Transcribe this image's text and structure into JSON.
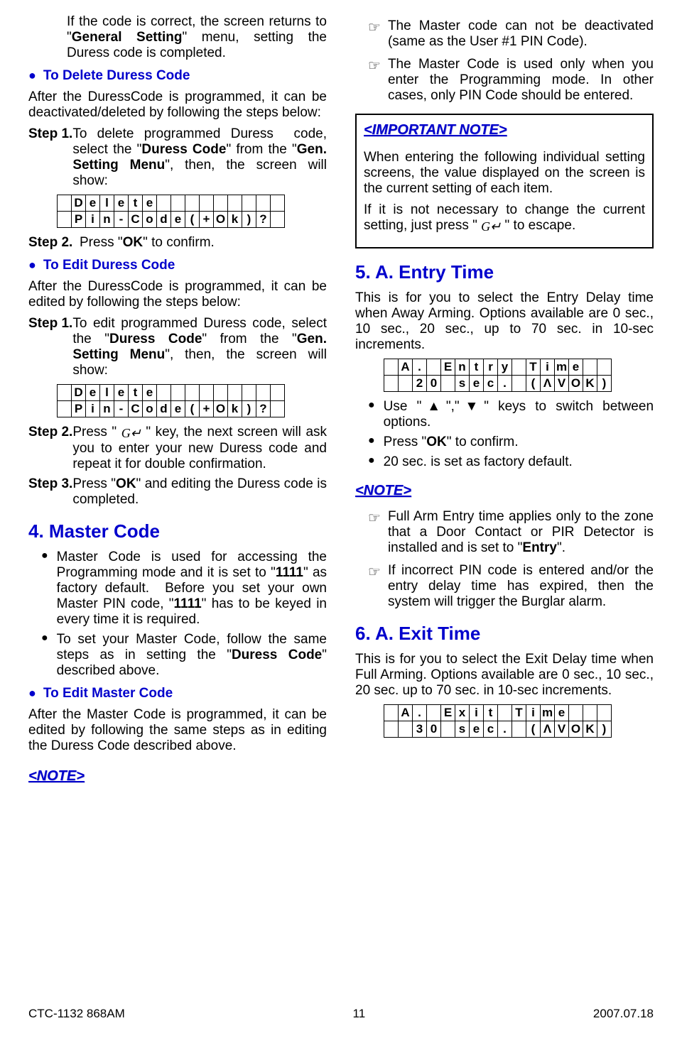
{
  "left": {
    "intro": "If the code is correct, the screen returns to \"General Setting\" menu, setting the Duress code is completed.",
    "delete_head": "To Delete Duress Code",
    "delete_intro": "After the DuressCode is programmed, it can be deactivated/deleted by following the steps below:",
    "delete_s1a": "Step 1.",
    "delete_s1b": "To delete programmed Duress  code, select the \"Duress Code\" from the \"Gen. Setting Menu\", then, the screen will show:",
    "lcd_delete_row1": [
      "",
      "",
      "D",
      "e",
      "l",
      "e",
      "t",
      "e",
      "",
      "",
      "",
      "",
      "",
      "",
      "",
      "",
      ""
    ],
    "lcd_delete_row2": [
      "",
      "",
      "P",
      "i",
      "n",
      "-",
      "C",
      "o",
      "d",
      "e",
      "(",
      "+",
      "O",
      "k",
      ")",
      "?"
    ],
    "delete_s2a": "Step  2.",
    "delete_s2b": "Press \"OK\" to confirm.",
    "edit_head": "To Edit Duress Code",
    "edit_intro": "After the DuressCode is programmed, it can be edited by following the steps below:",
    "edit_s1a": "Step 1.",
    "edit_s1b": "To edit programmed Duress code, select the \"Duress Code\" from the \"Gen. Setting Menu\", then, the screen will show:",
    "edit_s2a": "Step 2.",
    "edit_s2b_pre": "Press \" ",
    "edit_s2b_post": " \" key, the next screen will ask you to enter your new Duress code and repeat it for double confirmation.",
    "edit_s3a": "Step 3.",
    "edit_s3b": "Press \"OK\" and editing the Duress code is completed.",
    "master_head": "4. Master Code",
    "master_b1": "Master Code is used for accessing the Programming mode and it is set to \"1111\" as factory default.  Before you set your own Master PIN code, \"1111\" has to be keyed in every time it is required.",
    "master_b2": "To set your Master Code, follow the same steps as in setting the \"Duress Code\" described above.",
    "master_edit_head": "To Edit Master Code",
    "master_edit_txt": "After the Master Code is programmed, it can be edited by following the same steps as in editing the Duress Code described above.",
    "note_label": "<NOTE>"
  },
  "right": {
    "hand1": "The Master code can not be deactivated (same as the User #1 PIN Code).",
    "hand2": "The Master Code is used only when you enter the Programming mode.  In other cases, only PIN Code should be entered.",
    "imp_label": "<IMPORTANT NOTE>",
    "imp_p1": "When entering the following individual setting screens, the value displayed on the screen is the current setting of each item.",
    "imp_p2_pre": "If it is not necessary to change the current setting, just press \" ",
    "imp_p2_post": " \" to escape.",
    "entry_head": "5. A. Entry Time",
    "entry_p": "This is for you to select the Entry Delay time when Away Arming.  Options available are 0 sec., 10 sec., 20 sec., up to 70 sec. in 10-sec increments.",
    "lcd_entry_row1": [
      "",
      "",
      "A",
      ".",
      "",
      "E",
      "n",
      "t",
      "r",
      "y",
      "",
      "T",
      "i",
      "m",
      "e",
      ""
    ],
    "lcd_entry_row2": [
      "",
      "",
      "",
      "2",
      "0",
      "",
      "s",
      "e",
      "c",
      ".",
      "",
      "(",
      "Λ",
      "V",
      "O",
      "K",
      ")"
    ],
    "entry_b1": "Use \"▲\",\"▼\" keys to switch between options.",
    "entry_b2": "Press \"OK\" to confirm.",
    "entry_b3": "20 sec. is set as factory default.",
    "note_label": "<NOTE>",
    "entry_n1": "Full Arm Entry time applies only to the zone that a Door Contact or PIR Detector is installed and is set to \"Entry\".",
    "entry_n2": "If incorrect PIN code is entered and/or the entry delay time has expired, then the system will trigger the Burglar alarm.",
    "exit_head": "6. A. Exit Time",
    "exit_p": "This is for you to select the Exit Delay time when Full Arming.  Options available are 0 sec., 10 sec., 20 sec. up to 70 sec. in 10-sec increments.",
    "lcd_exit_row1": [
      "",
      "",
      "A",
      ".",
      "",
      "E",
      "x",
      "i",
      "t",
      "",
      "T",
      "i",
      "m",
      "e",
      "",
      ""
    ],
    "lcd_exit_row2": [
      "",
      "",
      "",
      "3",
      "0",
      "",
      "s",
      "e",
      "c",
      ".",
      "",
      "(",
      "Λ",
      "V",
      "O",
      "K",
      ")"
    ]
  },
  "footer": {
    "left": "CTC-1132 868AM",
    "center": "11",
    "right": "2007.07.18"
  }
}
